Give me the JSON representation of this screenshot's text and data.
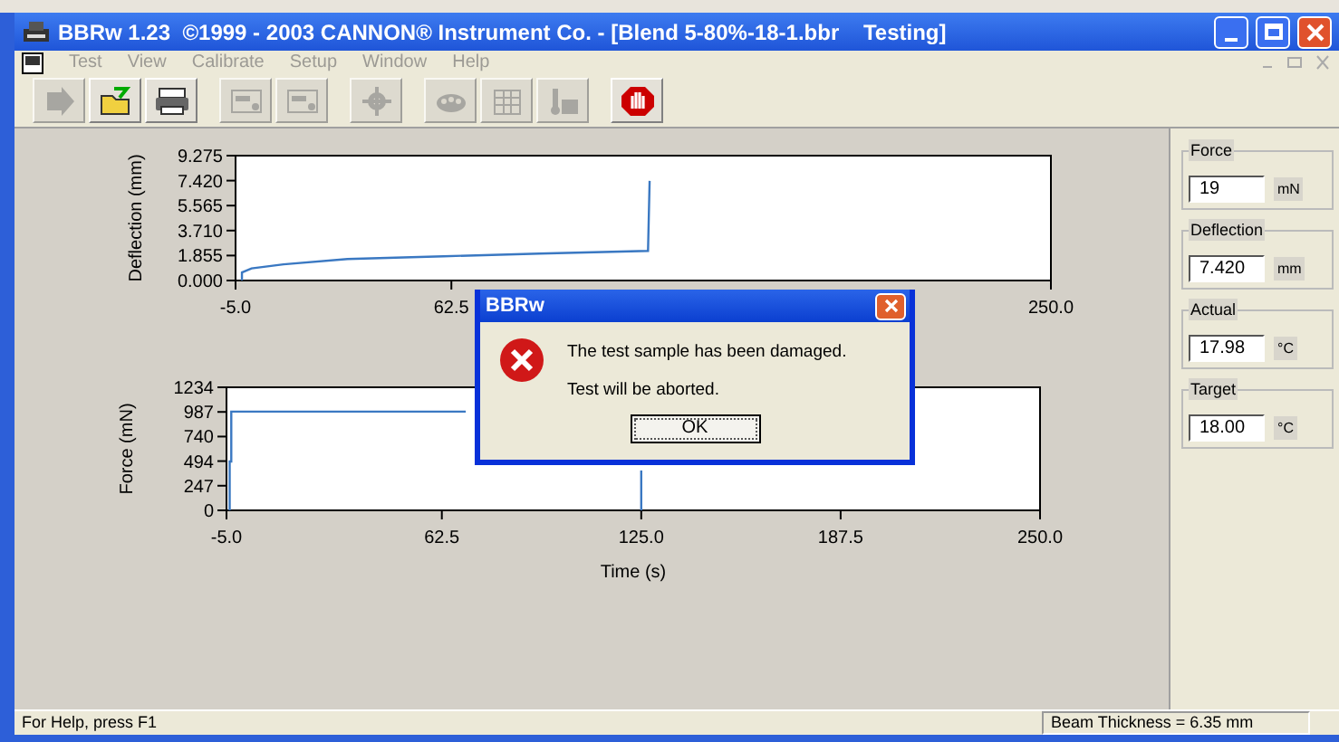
{
  "window": {
    "title": "BBRw 1.23  ©1999 - 2003 CANNON® Instrument Co. - [Blend 5-80%-18-1.bbr    Testing]"
  },
  "menu": [
    {
      "label": "Test",
      "disabled": true
    },
    {
      "label": "View",
      "disabled": true
    },
    {
      "label": "Calibrate",
      "disabled": true
    },
    {
      "label": "Setup",
      "disabled": true
    },
    {
      "label": "Window",
      "disabled": true
    },
    {
      "label": "Help",
      "disabled": true
    }
  ],
  "toolbar": [
    {
      "kind": "arrow",
      "disabled": true
    },
    {
      "kind": "open",
      "disabled": false
    },
    {
      "kind": "print",
      "disabled": false
    },
    {
      "kind": "gap"
    },
    {
      "kind": "panel",
      "disabled": true
    },
    {
      "kind": "panel",
      "disabled": true
    },
    {
      "kind": "gap"
    },
    {
      "kind": "gear",
      "disabled": true
    },
    {
      "kind": "gap"
    },
    {
      "kind": "bath",
      "disabled": true
    },
    {
      "kind": "table",
      "disabled": true
    },
    {
      "kind": "thermo",
      "disabled": true
    },
    {
      "kind": "gap"
    },
    {
      "kind": "stop",
      "disabled": false
    }
  ],
  "charts": [
    {
      "chart_data": {
        "type": "line",
        "ylabel": "Deflection (mm)",
        "xlim": [
          -5,
          250
        ],
        "ylim": [
          0,
          9.275
        ],
        "yticks": [
          {
            "value": 0,
            "label": "0.000"
          },
          {
            "value": 1.855,
            "label": "1.855"
          },
          {
            "value": 3.71,
            "label": "3.710"
          },
          {
            "value": 5.565,
            "label": "5.565"
          },
          {
            "value": 7.42,
            "label": "7.420"
          },
          {
            "value": 9.275,
            "label": "9.275"
          }
        ],
        "xticks": [
          {
            "value": -5,
            "label": "-5.0"
          },
          {
            "value": 62.5,
            "label": "62.5"
          },
          {
            "value": 250,
            "label": "250.0"
          }
        ],
        "series": [
          {
            "color": "#3a78c2",
            "x": [
              -3,
              -3,
              0,
              10,
              30,
              60,
              90,
              124,
              124.5
            ],
            "values": [
              0,
              0.6,
              0.9,
              1.2,
              1.6,
              1.8,
              2.0,
              2.2,
              7.4
            ]
          }
        ]
      }
    },
    {
      "chart_data": {
        "type": "line",
        "xlabel": "Time (s)",
        "ylabel": "Force (mN)",
        "xlim": [
          -5,
          250
        ],
        "ylim": [
          0,
          1234
        ],
        "yticks": [
          {
            "value": 0,
            "label": "0"
          },
          {
            "value": 247,
            "label": "247"
          },
          {
            "value": 494,
            "label": "494"
          },
          {
            "value": 740,
            "label": "740"
          },
          {
            "value": 987,
            "label": "987"
          },
          {
            "value": 1234,
            "label": "1234"
          }
        ],
        "xticks": [
          {
            "value": -5,
            "label": "-5.0"
          },
          {
            "value": 62.5,
            "label": "62.5"
          },
          {
            "value": 125,
            "label": "125.0"
          },
          {
            "value": 187.5,
            "label": "187.5"
          },
          {
            "value": 250,
            "label": "250.0"
          }
        ],
        "series": [
          {
            "color": "#3a78c2",
            "x": [
              -4,
              -4,
              -3.5,
              -3.5,
              70
            ],
            "values": [
              0,
              490,
              490,
              990,
              990
            ]
          },
          {
            "color": "#3a78c2",
            "x": [
              125,
              125
            ],
            "values": [
              400,
              0
            ]
          }
        ]
      }
    }
  ],
  "readouts": [
    {
      "label": "Force",
      "value": "19",
      "unit": "mN"
    },
    {
      "label": "Deflection",
      "value": "7.420",
      "unit": "mm"
    },
    {
      "label": "Actual",
      "value": "17.98",
      "unit": "°C"
    },
    {
      "label": "Target",
      "value": "18.00",
      "unit": "°C"
    }
  ],
  "dialog": {
    "title": "BBRw",
    "messages": [
      "The test sample has been damaged.",
      "Test will be aborted."
    ],
    "button": "OK"
  },
  "status_bar": {
    "help": "For Help, press F1",
    "beam": "Beam Thickness = 6.35 mm"
  }
}
